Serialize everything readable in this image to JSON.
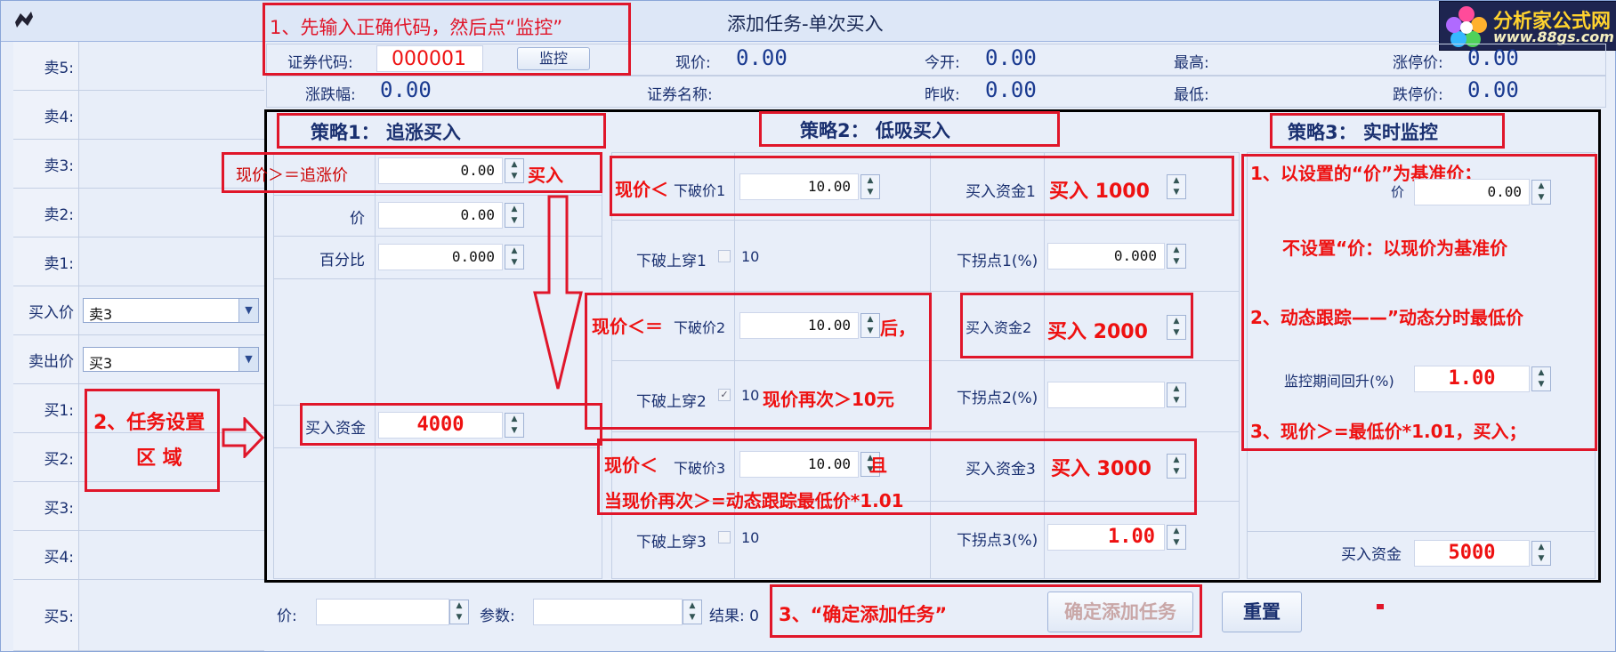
{
  "window": {
    "title": "添加任务-单次买入"
  },
  "logo": {
    "line1": "分析家公式网",
    "line2": "www.88gs.com"
  },
  "left_panel": {
    "rows": [
      {
        "label": "卖5:",
        "value": ""
      },
      {
        "label": "卖4:",
        "value": ""
      },
      {
        "label": "卖3:",
        "value": ""
      },
      {
        "label": "卖2:",
        "value": ""
      },
      {
        "label": "卖1:",
        "value": ""
      },
      {
        "label": "买入价",
        "value": "卖3"
      },
      {
        "label": "卖出价",
        "value": "买3"
      },
      {
        "label": "买1:",
        "value": ""
      },
      {
        "label": "买2:",
        "value": ""
      },
      {
        "label": "买3:",
        "value": ""
      },
      {
        "label": "买4:",
        "value": ""
      },
      {
        "label": "买5:",
        "value": ""
      }
    ]
  },
  "quote": {
    "code_label": "证券代码:",
    "code_value": "000001",
    "monitor_button": "监控",
    "price_label": "现价:",
    "price_value": "0.00",
    "open_label": "今开:",
    "open_value": "0.00",
    "high_label": "最高:",
    "high_value": "",
    "limitup_label": "涨停价:",
    "limitup_value": "0.00",
    "change_label": "涨跌幅:",
    "change_value": "0.00",
    "name_label": "证券名称:",
    "name_value": "",
    "prevclose_label": "昨收:",
    "prevclose_value": "0.00",
    "low_label": "最低:",
    "low_value": "",
    "limitdown_label": "跌停价:",
    "limitdown_value": "0.00"
  },
  "strategy1": {
    "title": "策略1：  追涨买入",
    "chase_label": "现价＞＝追涨价",
    "chase_value": "0.00",
    "chase_suffix": "买入",
    "price_label": "价",
    "price_value": "0.00",
    "percent_label": "百分比",
    "percent_value": "0.000",
    "capital_label": "买入资金",
    "capital_value": "4000"
  },
  "strategy2": {
    "title": "策略2：  低吸买入",
    "break1_prefix": "现价＜",
    "break1_label": "下破价1",
    "break1_value": "10.00",
    "capital1_label": "买入资金1",
    "capital1_value": "买入 1000",
    "cross1_label": "下破上穿1",
    "cross1_num": "10",
    "turn1_label": "下拐点1(%)",
    "turn1_value": "0.000",
    "break2_prefix": "现价＜＝",
    "break2_label": "下破价2",
    "break2_value": "10.00",
    "break2_suffix": "后，",
    "capital2_label": "买入资金2",
    "capital2_value": "买入 2000",
    "cross2_label": "下破上穿2",
    "cross2_num": "10",
    "cross2_note": "现价再次＞10元",
    "turn2_label": "下拐点2(%)",
    "turn2_value": "",
    "break3_prefix": "现价＜",
    "break3_label": "下破价3",
    "break3_value": "10.00",
    "break3_suffix": "且",
    "capital3_label": "买入资金3",
    "capital3_value": "买入 3000",
    "break3_note": "当现价再次＞=动态跟踪最低价*1.01",
    "cross3_label": "下破上穿3",
    "cross3_num": "10",
    "turn3_label": "下拐点3(%)",
    "turn3_value": "1.00"
  },
  "strategy3": {
    "title": "策略3：  实时监控",
    "note1": "1、以设置的“价”为基准价；",
    "price_label": "价",
    "price_value": "0.00",
    "note2": "不设置“价：以现价为基准价",
    "note3": "2、动态跟踪——”动态分时最低价",
    "rebound_label": "监控期间回升(%)",
    "rebound_value": "1.00",
    "note4": "3、现价＞=最低价*1.01，买入；",
    "capital_label": "买入资金",
    "capital_value": "5000"
  },
  "bottom": {
    "price_label": "价:",
    "param_label": "参数:",
    "result_label": "结果: 0",
    "confirm_button": "确定添加任务",
    "reset_button": "重置",
    "step3": "3、“确定添加任务”"
  },
  "annotations": {
    "step1": "1、先输入正确代码，然后点“监控”",
    "step2_line1": "2、任务设置",
    "step2_line2": "区  域"
  }
}
